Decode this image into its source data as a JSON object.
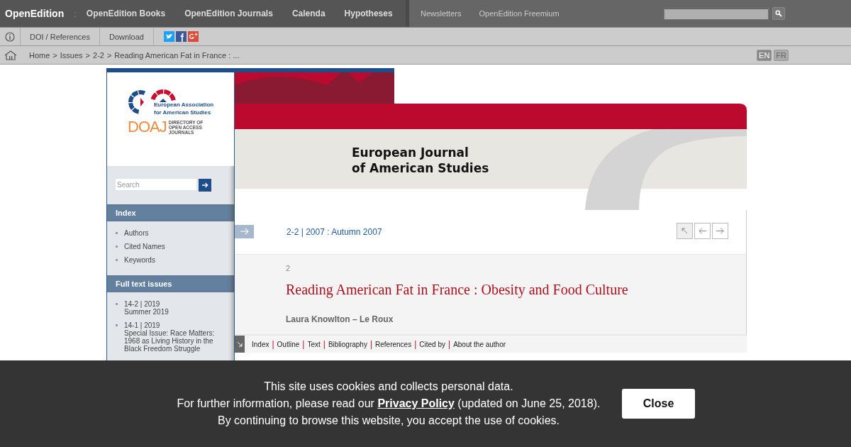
{
  "top_bar": {
    "brand": "OpenEdition",
    "separator": ":",
    "links": [
      "OpenEdition Books",
      "OpenEdition Journals",
      "Calenda",
      "Hypotheses"
    ],
    "secondary_links": [
      "Newsletters",
      "OpenEdition Freemium"
    ]
  },
  "toolbar": {
    "items": [
      "DOI / References",
      "Download"
    ],
    "share_icons": [
      {
        "kind": "twitter"
      },
      {
        "kind": "facebook"
      },
      {
        "kind": "googleplus"
      }
    ]
  },
  "breadcrumb": {
    "separator": ">",
    "items": [
      "Home",
      "Issues",
      "2-2",
      "Reading American Fat in France : ..."
    ],
    "languages": [
      {
        "label": "EN",
        "selected": true
      },
      {
        "label": "FR",
        "selected": false
      }
    ]
  },
  "sidebar": {
    "logo_text": [
      "European Association",
      "for American Studies"
    ],
    "doaj": {
      "mark": "DOAJ",
      "lines": [
        "DIRECTORY OF",
        "OPEN ACCESS",
        "JOURNALS"
      ]
    },
    "search": {
      "placeholder": "Search"
    },
    "sections": [
      {
        "title": "Index",
        "items": [
          {
            "lines": [
              "Authors"
            ]
          },
          {
            "lines": [
              "Cited Names"
            ]
          },
          {
            "lines": [
              "Keywords"
            ]
          }
        ]
      },
      {
        "title": "Full text issues",
        "items": [
          {
            "lines": [
              "14-2 | 2019",
              "Summer 2019"
            ]
          },
          {
            "lines": [
              "14-1 | 2019",
              "Special Issue: Race Matters: 1968 as Living History in the Black Freedom Struggle"
            ]
          }
        ]
      }
    ]
  },
  "banner": {
    "journal_title": [
      "European Journal",
      "of American Studies"
    ]
  },
  "issue": {
    "label": "2-2 | 2007 : Autumn 2007",
    "nav": [
      {
        "kind": "up"
      },
      {
        "kind": "prev"
      },
      {
        "kind": "next"
      }
    ]
  },
  "article": {
    "number": "2",
    "title": "Reading American Fat in France : Obesity and Food Culture",
    "author": "Laura Knowlton – Le Roux"
  },
  "article_tabs": {
    "separator": "|",
    "items": [
      "Index",
      "Outline",
      "Text",
      "Bibliography",
      "References",
      "Cited by",
      "About the author"
    ]
  },
  "cookie_notice": {
    "line_1": "This site uses cookies and collects personal data.",
    "line_2": {
      "before": "For further information, please read our ",
      "link": "Privacy Policy",
      "after": " (updated on June 25, 2018)."
    },
    "line_3": "By continuing to browse this website, you accept the use of cookies.",
    "button": "Close"
  }
}
